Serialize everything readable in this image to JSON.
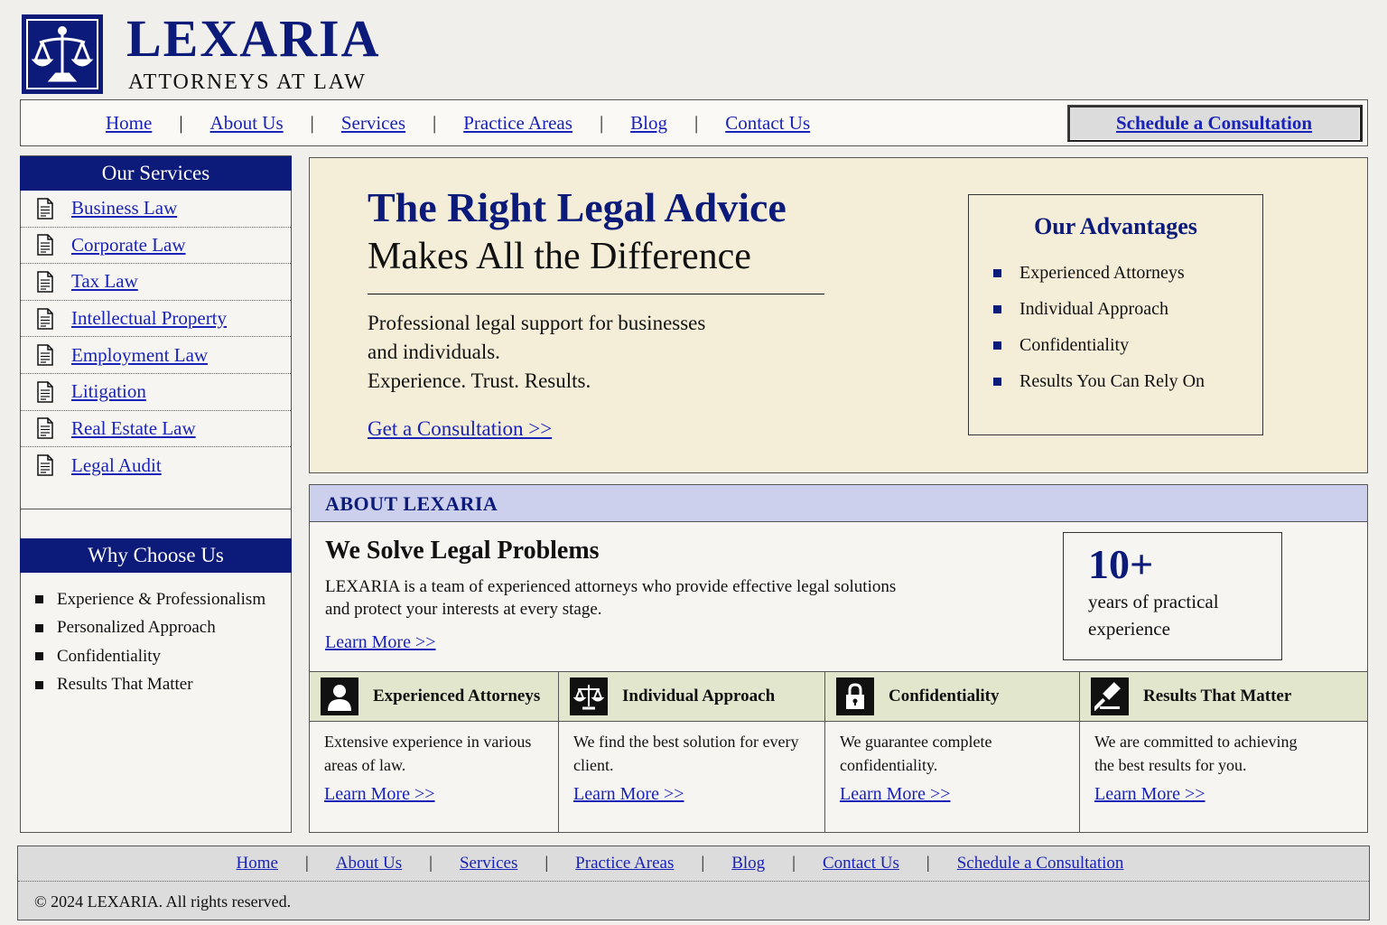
{
  "brand": {
    "name": "LEXARIA",
    "tagline": "ATTORNEYS AT LAW",
    "logo_icon": "scales-of-justice-icon"
  },
  "nav": {
    "items": [
      "Home",
      "About Us",
      "Services",
      "Practice Areas",
      "Blog",
      "Contact Us"
    ],
    "separator": "|",
    "cta_label": "Schedule a Consultation"
  },
  "sidebar": {
    "services_title": "Our Services",
    "services": [
      "Business Law",
      "Corporate Law",
      "Tax Law",
      "Intellectual Property",
      "Employment Law",
      "Litigation",
      "Real Estate Law",
      "Legal Audit"
    ],
    "service_icon": "document-icon",
    "why_title": "Why Choose Us",
    "why_items": [
      "Experience & Professionalism",
      "Personalized Approach",
      "Confidentiality",
      "Results That Matter"
    ]
  },
  "hero": {
    "title": "The Right Legal Advice",
    "subtitle": "Makes All the Difference",
    "desc_line1": "Professional legal support for businesses",
    "desc_line2": "and individuals.",
    "desc_line3": "Experience. Trust. Results.",
    "link": "Get a Consultation >>",
    "advantages_title": "Our Advantages",
    "advantages": [
      "Experienced Attorneys",
      "Individual Approach",
      "Confidentiality",
      "Results You Can Rely On"
    ]
  },
  "about": {
    "section_label": "ABOUT LEXARIA",
    "title": "We Solve Legal Problems",
    "text": "LEXARIA is a team of experienced attorneys who provide effective legal solutions and protect your interests at every stage.",
    "link": "Learn More >>",
    "stat_number": "10+",
    "stat_label": "years of practical experience"
  },
  "cards": [
    {
      "icon": "person-icon",
      "title": "Experienced Attorneys",
      "text": "Extensive experience in various areas of law.",
      "link": "Learn More >>"
    },
    {
      "icon": "scales-icon",
      "title": "Individual Approach",
      "text": "We find the best solution for every client.",
      "link": "Learn More >>"
    },
    {
      "icon": "padlock-icon",
      "title": "Confidentiality",
      "text": "We guarantee complete confidentiality.",
      "link": "Learn More >>"
    },
    {
      "icon": "gavel-icon",
      "title": "Results That Matter",
      "text": "We are committed to achieving the best results for you.",
      "link": "Learn More >>"
    }
  ],
  "footer": {
    "links": [
      "Home",
      "About Us",
      "Services",
      "Practice Areas",
      "Blog",
      "Contact Us",
      "Schedule a Consultation"
    ],
    "copyright": "© 2024 LEXARIA. All rights reserved."
  },
  "colors": {
    "brand_navy": "#0c1a7a",
    "link_blue": "#1a23b8",
    "hero_bg": "#f4edd7",
    "about_head_bg": "#cdd0ec",
    "card_head_bg": "#e2e6cd"
  }
}
